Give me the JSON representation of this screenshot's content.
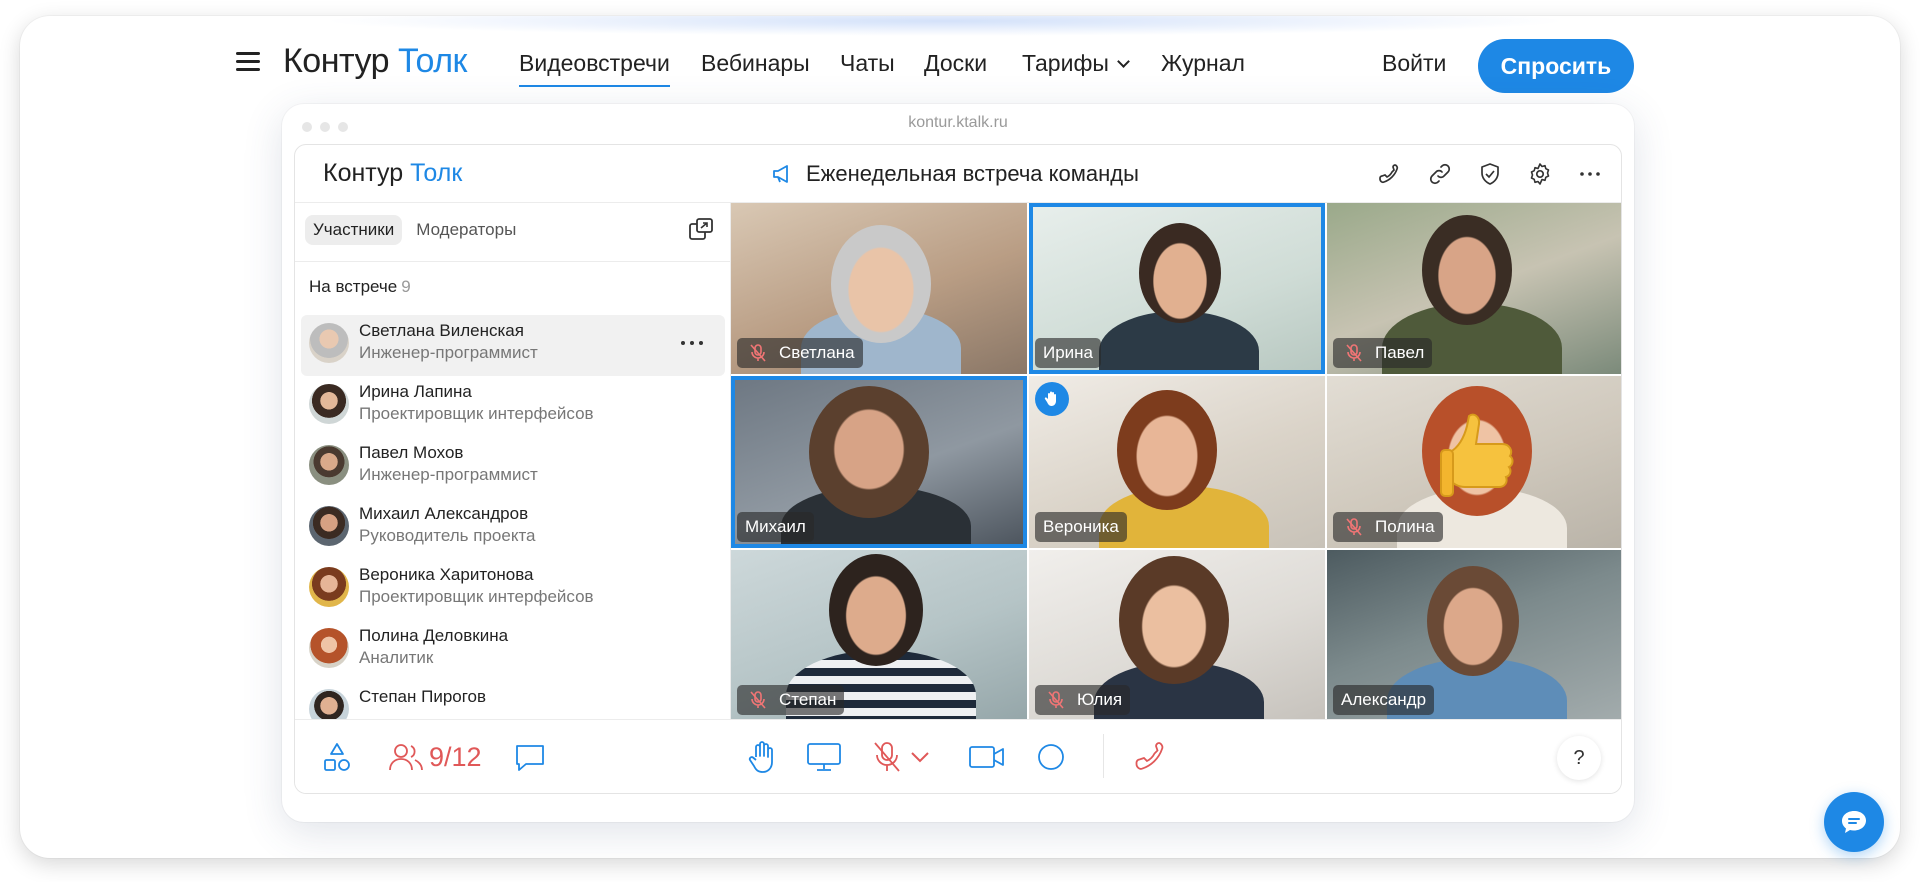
{
  "nav": {
    "logo_part1": "Контур",
    "logo_part2": "Толк",
    "items": [
      "Видеовстречи",
      "Вебинары",
      "Чаты",
      "Доски",
      "Тарифы",
      "Журнал"
    ],
    "active_item": "Видеовстречи",
    "login": "Войти",
    "ask_button": "Спросить"
  },
  "browser": {
    "url": "kontur.ktalk.ru"
  },
  "app": {
    "logo_part1": "Контур",
    "logo_part2": "Толк",
    "meeting_title": "Еженедельная встреча команды",
    "header_icons": [
      "phone-icon",
      "link-icon",
      "shield-check-icon",
      "settings-gear-icon",
      "more-dots-icon"
    ],
    "sidebar": {
      "tabs": [
        "Участники",
        "Модераторы"
      ],
      "active_tab": "Участники",
      "section_title": "На встрече",
      "section_count": "9",
      "participants": [
        {
          "name": "Светлана Виленская",
          "role": "Инженер-программист"
        },
        {
          "name": "Ирина Лапина",
          "role": "Проектировщик интерфейсов"
        },
        {
          "name": "Павел Мохов",
          "role": "Инженер-программист"
        },
        {
          "name": "Михаил Александров",
          "role": "Руководитель проекта"
        },
        {
          "name": "Вероника Харитонова",
          "role": "Проектировщик интерфейсов"
        },
        {
          "name": "Полина Деловкина",
          "role": "Аналитик"
        },
        {
          "name": "Степан Пирогов",
          "role": ""
        }
      ]
    },
    "tiles": [
      {
        "name": "Светлана",
        "muted": true,
        "speaking": false,
        "hand": false
      },
      {
        "name": "Ирина",
        "muted": false,
        "speaking": true,
        "hand": false
      },
      {
        "name": "Павел",
        "muted": true,
        "speaking": false,
        "hand": false
      },
      {
        "name": "Михаил",
        "muted": false,
        "speaking": true,
        "hand": false
      },
      {
        "name": "Вероника",
        "muted": false,
        "speaking": false,
        "hand": true
      },
      {
        "name": "Полина",
        "muted": true,
        "speaking": false,
        "hand": false
      },
      {
        "name": "Степан",
        "muted": true,
        "speaking": false,
        "hand": false
      },
      {
        "name": "Юлия",
        "muted": true,
        "speaking": false,
        "hand": false
      },
      {
        "name": "Александр",
        "muted": false,
        "speaking": false,
        "hand": false
      }
    ],
    "bottom_bar": {
      "participants_count": "9/12",
      "help": "?"
    }
  },
  "colors": {
    "accent": "#1e88e5",
    "muted_red": "#e05858"
  }
}
